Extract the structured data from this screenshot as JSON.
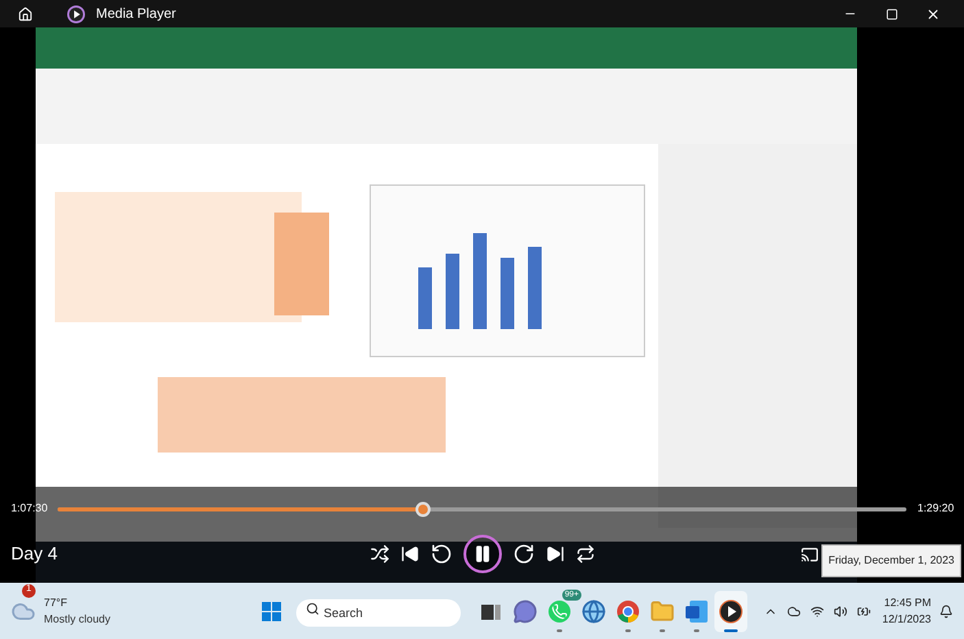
{
  "window": {
    "title": "Media Player"
  },
  "player": {
    "elapsed": "1:07:30",
    "total": "1:29:20",
    "level": 0.43,
    "title": "Day 4",
    "playing": true
  },
  "tooltip": "Friday, December 1, 2023",
  "taskbar": {
    "weather": {
      "temp": "77°F",
      "condition": "Mostly cloudy",
      "badge": "1"
    },
    "search": {
      "placeholder": "Search"
    },
    "apps": [
      {
        "kind": "taskview",
        "running": false,
        "selected": false
      },
      {
        "kind": "chat",
        "running": false,
        "selected": false
      },
      {
        "kind": "whatsapp",
        "running": true,
        "selected": false,
        "badge": "99+"
      },
      {
        "kind": "globe",
        "running": false,
        "selected": false
      },
      {
        "kind": "chrome",
        "running": true,
        "selected": false
      },
      {
        "kind": "folder",
        "running": true,
        "selected": false
      },
      {
        "kind": "word",
        "running": true,
        "selected": false
      },
      {
        "kind": "player",
        "running": true,
        "selected": true
      }
    ],
    "time": "12:45 PM",
    "date": "12/1/2023"
  }
}
